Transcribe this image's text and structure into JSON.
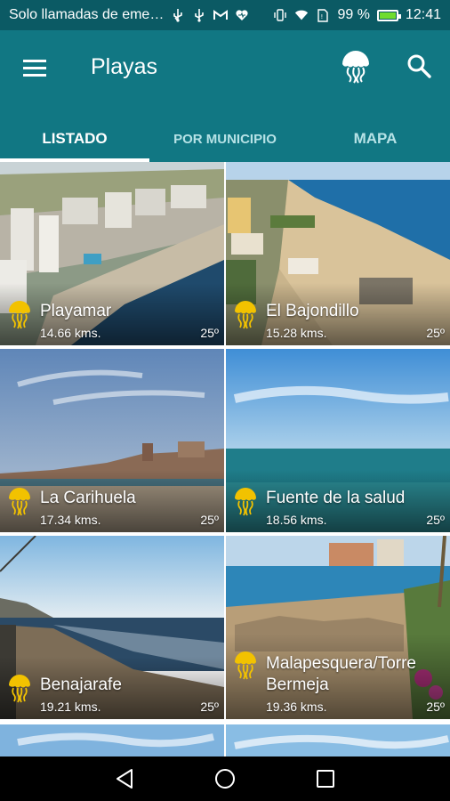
{
  "status_bar": {
    "notification_text": "Solo llamadas de eme…",
    "battery_percent": "99 %",
    "battery_level": 0.99,
    "time": "12:41",
    "icons": [
      "usb-icon",
      "usb-icon",
      "gmail-icon",
      "heart-icon",
      "vibrate-icon",
      "wifi-icon",
      "sim-icon",
      "battery-icon"
    ]
  },
  "app_bar": {
    "title": "Playas",
    "icons": [
      "menu-icon",
      "jellyfish-icon",
      "search-icon"
    ]
  },
  "tabs": [
    {
      "label": "LISTADO",
      "active": true
    },
    {
      "label": "POR MUNICIPIO",
      "active": false
    },
    {
      "label": "MAPA",
      "active": false
    }
  ],
  "beaches": [
    {
      "name": "Playamar",
      "distance": "14.66 kms.",
      "temperature": "25º"
    },
    {
      "name": "El Bajondillo",
      "distance": "15.28 kms.",
      "temperature": "25º"
    },
    {
      "name": "La Carihuela",
      "distance": "17.34 kms.",
      "temperature": "25º"
    },
    {
      "name": "Fuente de la salud",
      "distance": "18.56 kms.",
      "temperature": "25º"
    },
    {
      "name": "Benajarafe",
      "distance": "19.21 kms.",
      "temperature": "25º"
    },
    {
      "name_line1": "Malapesquera/Torre",
      "name_line2": "Bermeja",
      "distance": "19.36 kms.",
      "temperature": "25º"
    }
  ],
  "colors": {
    "status_bar": "#0b5a64",
    "app_bar": "#117783",
    "tab_inactive": "#b6e2e6",
    "jellyfish_badge": "#f2c200",
    "battery_fill": "#6fdc2f"
  },
  "nav_bar": {
    "icons": [
      "back-icon",
      "home-icon",
      "recents-icon"
    ]
  }
}
